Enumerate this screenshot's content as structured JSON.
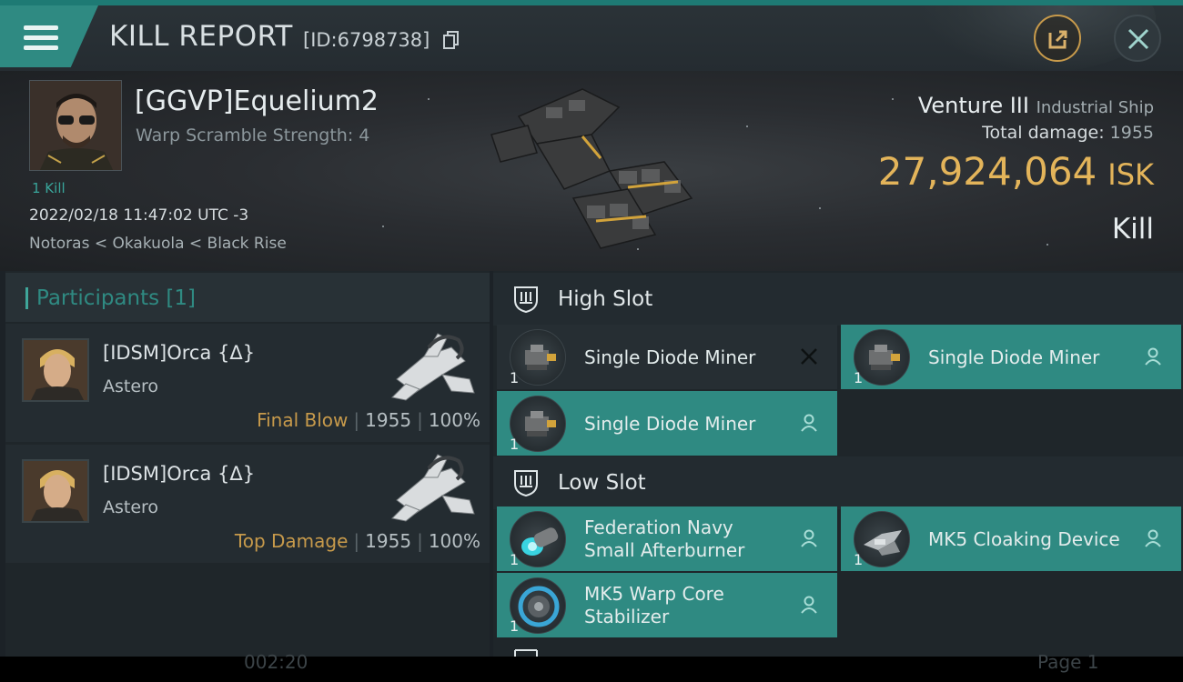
{
  "header": {
    "title": "KILL REPORT",
    "report_id": "[ID:6798738]"
  },
  "victim": {
    "pilot_name": "[GGVP]Equelium2",
    "warp_scramble": "Warp Scramble Strength: 4",
    "kills": "1 Kill",
    "datetime": "2022/02/18 11:47:02 UTC -3",
    "location": "Notoras < Okakuola < Black Rise",
    "ship_name": "Venture III",
    "ship_class": "Industrial Ship",
    "total_damage_label": "Total damage:",
    "total_damage_value": "1955",
    "isk_value": "27,924,064",
    "isk_unit": "ISK",
    "kill_type": "Kill"
  },
  "participants": {
    "title": "Participants",
    "count": "[1]",
    "rows": [
      {
        "name": "[IDSM]Orca {Δ}",
        "ship": "Astero",
        "label": "Final Blow",
        "damage": "1955",
        "percent": "100%"
      },
      {
        "name": "[IDSM]Orca {Δ}",
        "ship": "Astero",
        "label": "Top Damage",
        "damage": "1955",
        "percent": "100%"
      }
    ]
  },
  "fitting": {
    "high_slot": {
      "title": "High Slot",
      "modules": [
        {
          "name": "Single Diode Miner",
          "qty": "1",
          "status": "destroyed"
        },
        {
          "name": "Single Diode Miner",
          "qty": "1",
          "status": "dropped"
        },
        {
          "name": "Single Diode Miner",
          "qty": "1",
          "status": "dropped"
        }
      ]
    },
    "low_slot": {
      "title": "Low Slot",
      "modules": [
        {
          "name_line1": "Federation Navy",
          "name_line2": "Small Afterburner",
          "qty": "1",
          "status": "dropped"
        },
        {
          "name": "MK5 Cloaking Device",
          "qty": "1",
          "status": "dropped"
        },
        {
          "name_line1": "MK5 Warp Core",
          "name_line2": "Stabilizer",
          "qty": "1",
          "status": "dropped"
        }
      ]
    }
  },
  "footer": {
    "left_text": "002:20",
    "page_text": "Page 1"
  },
  "colors": {
    "accent_teal": "#2f8a82",
    "isk_gold": "#e3b45a",
    "label_gold": "#c79a4b",
    "background": "#1c2227"
  }
}
